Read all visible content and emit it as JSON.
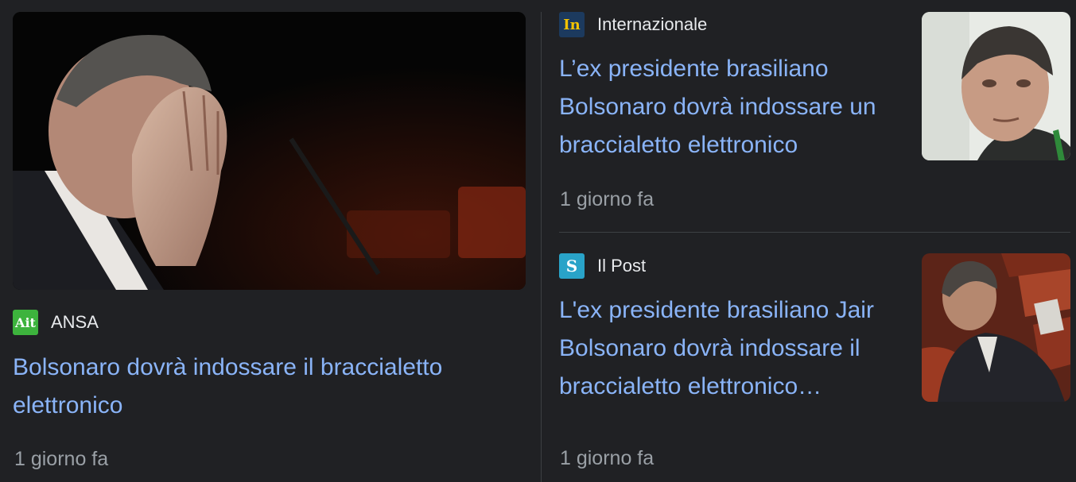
{
  "main_story": {
    "image_alt": "Jair Bolsonaro covering his face with his hand",
    "source": {
      "name": "ANSA",
      "icon": "ansa-logo-icon",
      "icon_text": "Ait",
      "color": "#3db33d"
    },
    "headline": "Bolsonaro dovrà indossare il braccialetto elettronico",
    "time": "1 giorno fa"
  },
  "stories": [
    {
      "source": {
        "name": "Internazionale",
        "icon": "internazionale-logo-icon",
        "icon_text": "In",
        "color": "#1e3a5f"
      },
      "headline": "L’ex presidente brasiliano Bolsonaro dovrà indossare un braccialetto elettronico",
      "time": "1 giorno fa",
      "thumbnail_alt": "Portrait of Jair Bolsonaro"
    },
    {
      "source": {
        "name": "Il Post",
        "icon": "ilpost-logo-icon",
        "icon_text": "S",
        "color": "#29a3c8"
      },
      "headline": "L'ex presidente brasiliano Jair Bolsonaro dovrà indossare il braccialetto elettronico…",
      "time": "1 giorno fa",
      "thumbnail_alt": "Jair Bolsonaro seated in red chairs"
    }
  ]
}
